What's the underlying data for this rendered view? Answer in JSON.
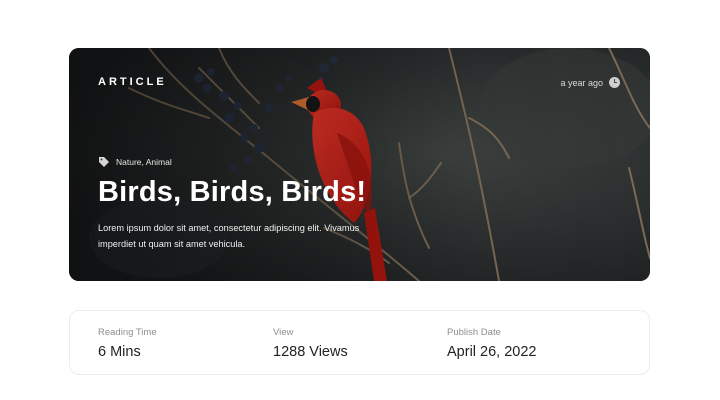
{
  "hero": {
    "kicker": "ARTICLE",
    "time_ago": "a year ago",
    "tags": "Nature, Animal",
    "title": "Birds, Birds, Birds!",
    "description": "Lorem ipsum dolor sit amet, consectetur adipiscing elit. Vivamus imperdiet ut quam sit amet vehicula."
  },
  "stats": [
    {
      "label": "Reading Time",
      "value": "6 Mins"
    },
    {
      "label": "View",
      "value": "1288 Views"
    },
    {
      "label": "Publish Date",
      "value": "April 26, 2022"
    }
  ],
  "icons": {
    "tag": "tag-icon",
    "time": "clock-icon"
  },
  "colors": {
    "bird": "#d9261c",
    "card_border": "#ececec",
    "label_gray": "#8e8e8e"
  }
}
